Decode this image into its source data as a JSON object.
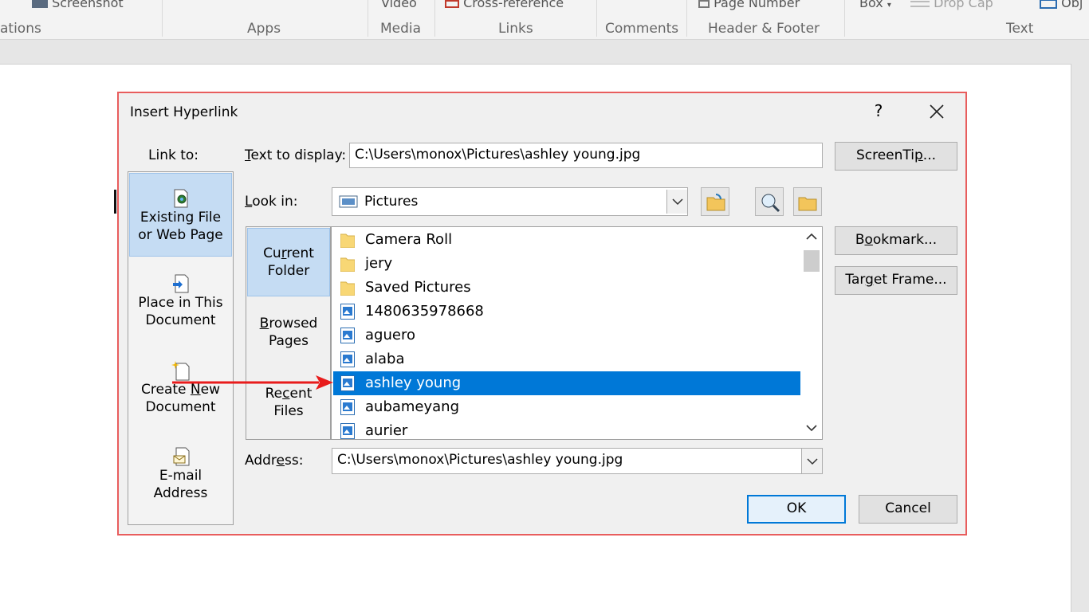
{
  "ribbon": {
    "top_items": [
      "Screenshot",
      "Video",
      "Cross-reference",
      "Page Number",
      "Box",
      "Drop Cap",
      "Obj"
    ],
    "groups": [
      "ations",
      "Apps",
      "Media",
      "Links",
      "Comments",
      "Header & Footer",
      "Text"
    ]
  },
  "dialog": {
    "title": "Insert Hyperlink",
    "help": "?",
    "link_to_label": "Link to:",
    "link_to": [
      {
        "line1": "Existing File",
        "line2": "or Web Page",
        "icon": "existing-file-icon"
      },
      {
        "line1": "Place in This",
        "line2": "Document",
        "icon": "place-in-document-icon"
      },
      {
        "line1": "Create New",
        "line2": "Document",
        "icon": "create-new-document-icon"
      },
      {
        "line1": "E-mail",
        "line2": "Address",
        "icon": "email-address-icon"
      }
    ],
    "text_to_display_label": "Text to display:",
    "text_to_display_value": "C:\\Users\\monox\\Pictures\\ashley young.jpg",
    "screentip_label": "ScreenTip...",
    "look_in_label": "Look in:",
    "look_in_value": "Pictures",
    "subnav": [
      {
        "line1": "Current",
        "line2": "Folder"
      },
      {
        "line1": "Browsed",
        "line2": "Pages"
      },
      {
        "line1": "Recent",
        "line2": "Files"
      }
    ],
    "files": [
      {
        "name": "Camera Roll",
        "type": "folder"
      },
      {
        "name": "jery",
        "type": "folder"
      },
      {
        "name": "Saved Pictures",
        "type": "folder"
      },
      {
        "name": "1480635978668",
        "type": "image"
      },
      {
        "name": "aguero",
        "type": "image"
      },
      {
        "name": "alaba",
        "type": "image"
      },
      {
        "name": "ashley young",
        "type": "image"
      },
      {
        "name": "aubameyang",
        "type": "image"
      },
      {
        "name": "aurier",
        "type": "image"
      }
    ],
    "selected_file": "ashley young",
    "bookmark_label": "Bookmark...",
    "target_frame_label": "Target Frame...",
    "address_label": "Address:",
    "address_value": "C:\\Users\\monox\\Pictures\\ashley young.jpg",
    "ok_label": "OK",
    "cancel_label": "Cancel"
  },
  "colors": {
    "selection": "#0078d7",
    "nav_selection": "#c5dcf3",
    "annotation_red": "#e81c1c",
    "dialog_border": "#e85d5d"
  }
}
